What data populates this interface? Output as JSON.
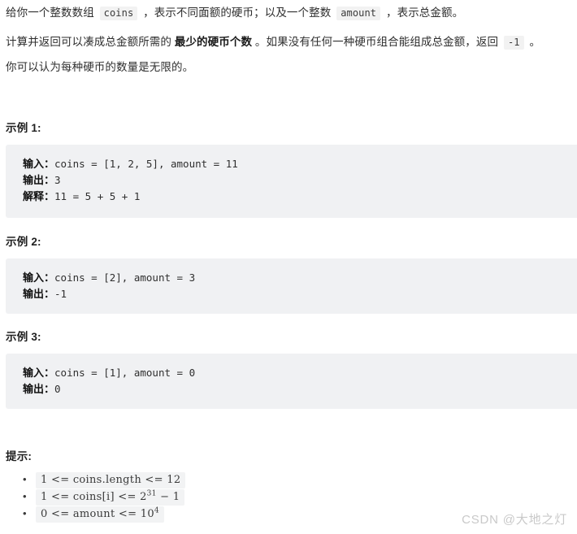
{
  "description": {
    "paragraph1": {
      "seg1": "给你一个整数数组 ",
      "code1": "coins",
      "seg2": " ，表示不同面额的硬币；以及一个整数 ",
      "code2": "amount",
      "seg3": " ，表示总金额。"
    },
    "paragraph2": {
      "seg1": "计算并返回可以凑成总金额所需的 ",
      "bold1": "最少的硬币个数",
      "seg2": " 。如果没有任何一种硬币组合能组成总金额，返回 ",
      "code1": "-1",
      "seg3": " 。"
    },
    "paragraph3": {
      "text": "你可以认为每种硬币的数量是无限的。"
    }
  },
  "examples": [
    {
      "heading": "示例 1:",
      "lines": [
        {
          "label": "输入：",
          "value": "coins = [1, 2, 5], amount = 11"
        },
        {
          "label": "输出：",
          "value": "3"
        },
        {
          "label": "解释：",
          "value": "11 = 5 + 5 + 1"
        }
      ]
    },
    {
      "heading": "示例 2:",
      "lines": [
        {
          "label": "输入：",
          "value": "coins = [2], amount = 3"
        },
        {
          "label": "输出：",
          "value": "-1"
        }
      ]
    },
    {
      "heading": "示例 3:",
      "lines": [
        {
          "label": "输入：",
          "value": "coins = [1], amount = 0"
        },
        {
          "label": "输出：",
          "value": "0"
        }
      ]
    }
  ],
  "hints": {
    "heading": "提示:",
    "constraints": [
      {
        "prefix": "1 <= coins.length <= 12",
        "sup": "",
        "suffix": ""
      },
      {
        "prefix": "1 <= coins[i] <= 2",
        "sup": "31",
        "suffix": " − 1"
      },
      {
        "prefix": "0 <= amount <= 10",
        "sup": "4",
        "suffix": ""
      }
    ]
  },
  "watermark": {
    "text": "CSDN @大地之灯"
  },
  "colors": {
    "code_block_bg": "#f0f1f3",
    "inline_code_bg": "#f2f2f2",
    "formula_bg": "#f2f3f4",
    "text": "#2e2e2e",
    "watermark": "#c9c9c9"
  }
}
